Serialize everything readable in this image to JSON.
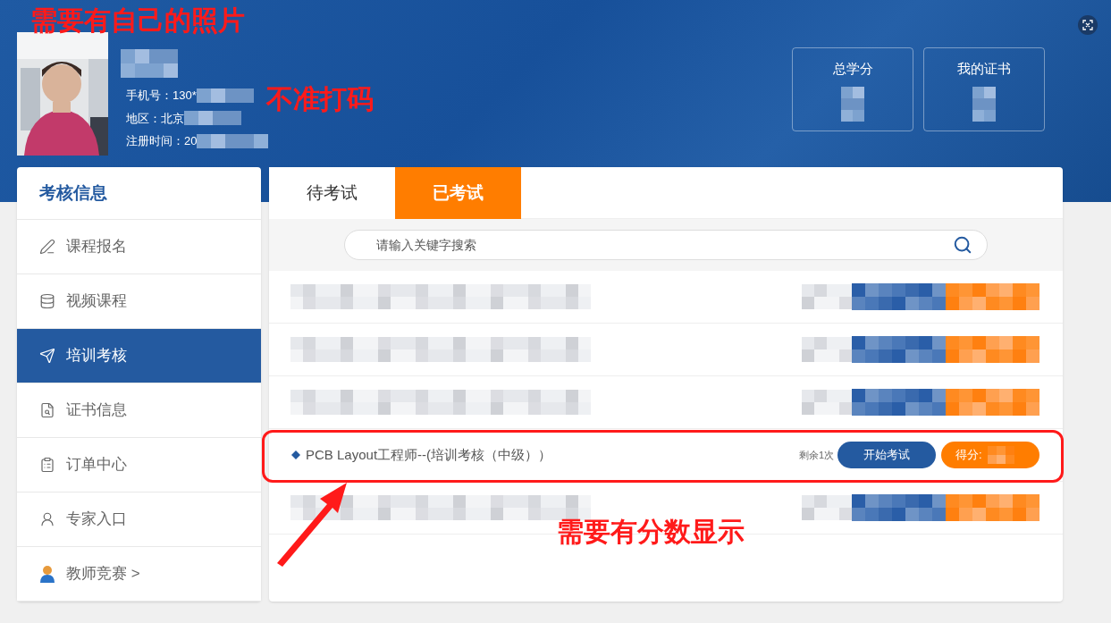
{
  "profile": {
    "phone": "手机号：130*",
    "region": "地区：北京",
    "registered": "注册时间：20"
  },
  "stats": [
    {
      "label": "总学分"
    },
    {
      "label": "我的证书"
    }
  ],
  "sidebar": {
    "title": "考核信息",
    "items": [
      {
        "label": "课程报名",
        "selected": false
      },
      {
        "label": "视频课程",
        "selected": false
      },
      {
        "label": "培训考核",
        "selected": true
      },
      {
        "label": "证书信息",
        "selected": false
      },
      {
        "label": "订单中心",
        "selected": false
      },
      {
        "label": "专家入口",
        "selected": false
      },
      {
        "label": "教师竞赛 >",
        "selected": false
      }
    ]
  },
  "tabs": [
    {
      "label": "待考试",
      "selected": false
    },
    {
      "label": "已考试",
      "selected": true
    }
  ],
  "search": {
    "placeholder": "请输入关键字搜索"
  },
  "exams": [
    {
      "kind": "blurred"
    },
    {
      "kind": "blurred"
    },
    {
      "kind": "blurred"
    },
    {
      "kind": "exam",
      "title": "PCB Layout工程师--(培训考核（中级））",
      "remaining": "剩余1次",
      "start": "开始考试",
      "score": "得分:"
    },
    {
      "kind": "blurred"
    }
  ],
  "annotations": {
    "photo_note": "需要有自己的照片",
    "mosaic_note": "不准打码",
    "score_note": "需要有分数显示"
  }
}
